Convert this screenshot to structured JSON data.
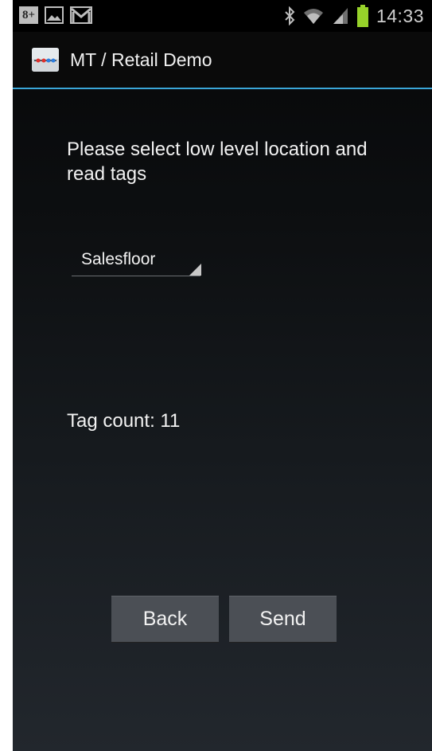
{
  "status_bar": {
    "time": "14:33",
    "icons": [
      "google-plus-icon",
      "gallery-icon",
      "gmail-icon",
      "bluetooth-icon",
      "wifi-icon",
      "signal-icon",
      "battery-icon"
    ],
    "gplus_label": "8+"
  },
  "action_bar": {
    "title": "MT / Retail Demo",
    "accent_color": "#3aa6d8"
  },
  "main": {
    "prompt": "Please select low level location and read tags",
    "location_spinner": {
      "selected": "Salesfloor"
    },
    "tag_count": "Tag count: 11",
    "buttons": {
      "back": "Back",
      "send": "Send"
    }
  }
}
